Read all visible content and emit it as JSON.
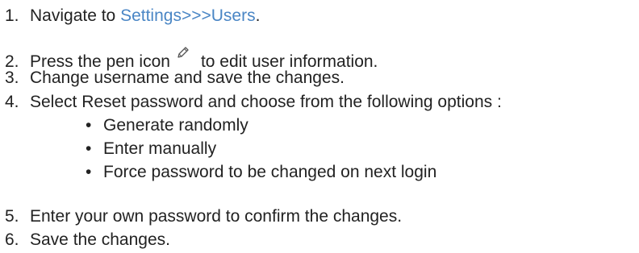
{
  "steps": [
    {
      "number": "1.",
      "prefix": "Navigate to ",
      "link": "Settings>>>Users",
      "suffix": "."
    },
    {
      "number": "2.",
      "prefix": "Press the pen icon",
      "icon": "pen-icon",
      "suffix": "to edit user information."
    },
    {
      "number": "3.",
      "text": "Change username and save the changes."
    },
    {
      "number": "4.",
      "text": "Select Reset password and choose from the following options :",
      "options": [
        "Generate randomly",
        "Enter manually",
        "Force password to be changed on next login"
      ]
    },
    {
      "number": "5.",
      "text": "Enter your own password to confirm the changes."
    },
    {
      "number": "6.",
      "text": "Save the changes."
    }
  ],
  "colors": {
    "text": "#222222",
    "link": "#4a86c5",
    "icon_stroke": "#555555"
  }
}
